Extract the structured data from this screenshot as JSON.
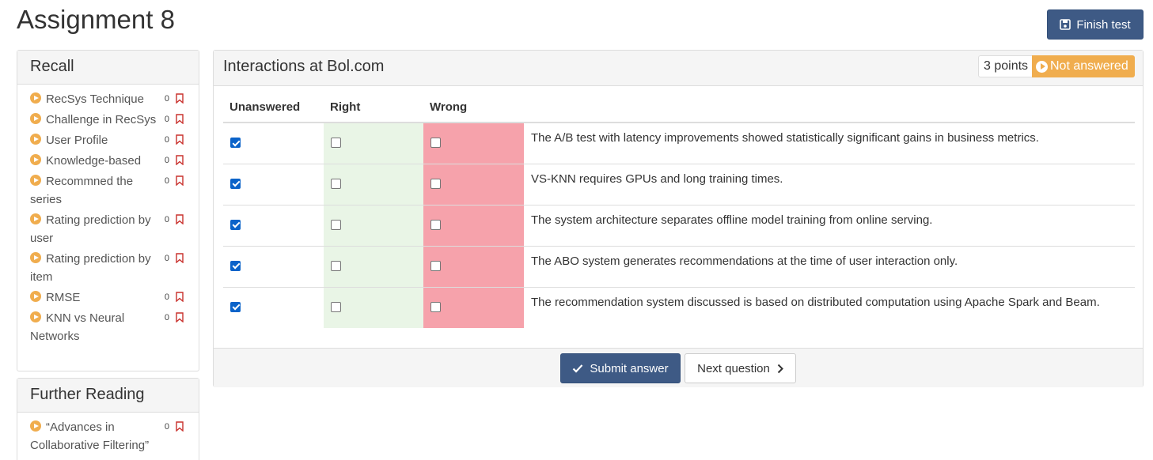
{
  "page": {
    "title": "Assignment 8"
  },
  "header": {
    "finish_label": "Finish test"
  },
  "sidebar": {
    "sections": [
      {
        "title": "Recall",
        "items": [
          {
            "label": "RecSys Technique",
            "count": "0"
          },
          {
            "label": "Challenge in RecSys",
            "count": "0"
          },
          {
            "label": "User Profile",
            "count": "0"
          },
          {
            "label": "Knowledge-based",
            "count": "0"
          },
          {
            "label": "Recommned the series",
            "count": "0"
          },
          {
            "label": "Rating prediction by user",
            "count": "0"
          },
          {
            "label": "Rating prediction by item",
            "count": "0"
          },
          {
            "label": "RMSE",
            "count": "0"
          },
          {
            "label": "KNN vs Neural Networks",
            "count": "0"
          }
        ]
      },
      {
        "title": "Further Reading",
        "items": [
          {
            "label": "“Advances in Collaborative Filtering”",
            "count": "0"
          }
        ]
      }
    ]
  },
  "question": {
    "title": "Interactions at Bol.com",
    "points": "3 points",
    "status": "Not answered",
    "columns": {
      "unanswered": "Unanswered",
      "right": "Right",
      "wrong": "Wrong"
    },
    "rows": [
      {
        "statement": "The A/B test with latency improvements showed statistically significant gains in business metrics.",
        "selected": "unanswered"
      },
      {
        "statement": "VS-KNN requires GPUs and long training times.",
        "selected": "unanswered"
      },
      {
        "statement": "The system architecture separates offline model training from online serving.",
        "selected": "unanswered"
      },
      {
        "statement": "The ABO system generates recommendations at the time of user interaction only.",
        "selected": "unanswered"
      },
      {
        "statement": "The recommendation system discussed is based on distributed computation using Apache Spark and Beam.",
        "selected": "unanswered"
      }
    ],
    "submit_label": "Submit answer",
    "next_label": "Next question"
  },
  "colors": {
    "primary": "#3e5a85",
    "warning": "#f0ad4e",
    "right_bg": "#e9f5e6",
    "wrong_bg": "#f6a2ab",
    "bookmark": "#c9302c"
  }
}
